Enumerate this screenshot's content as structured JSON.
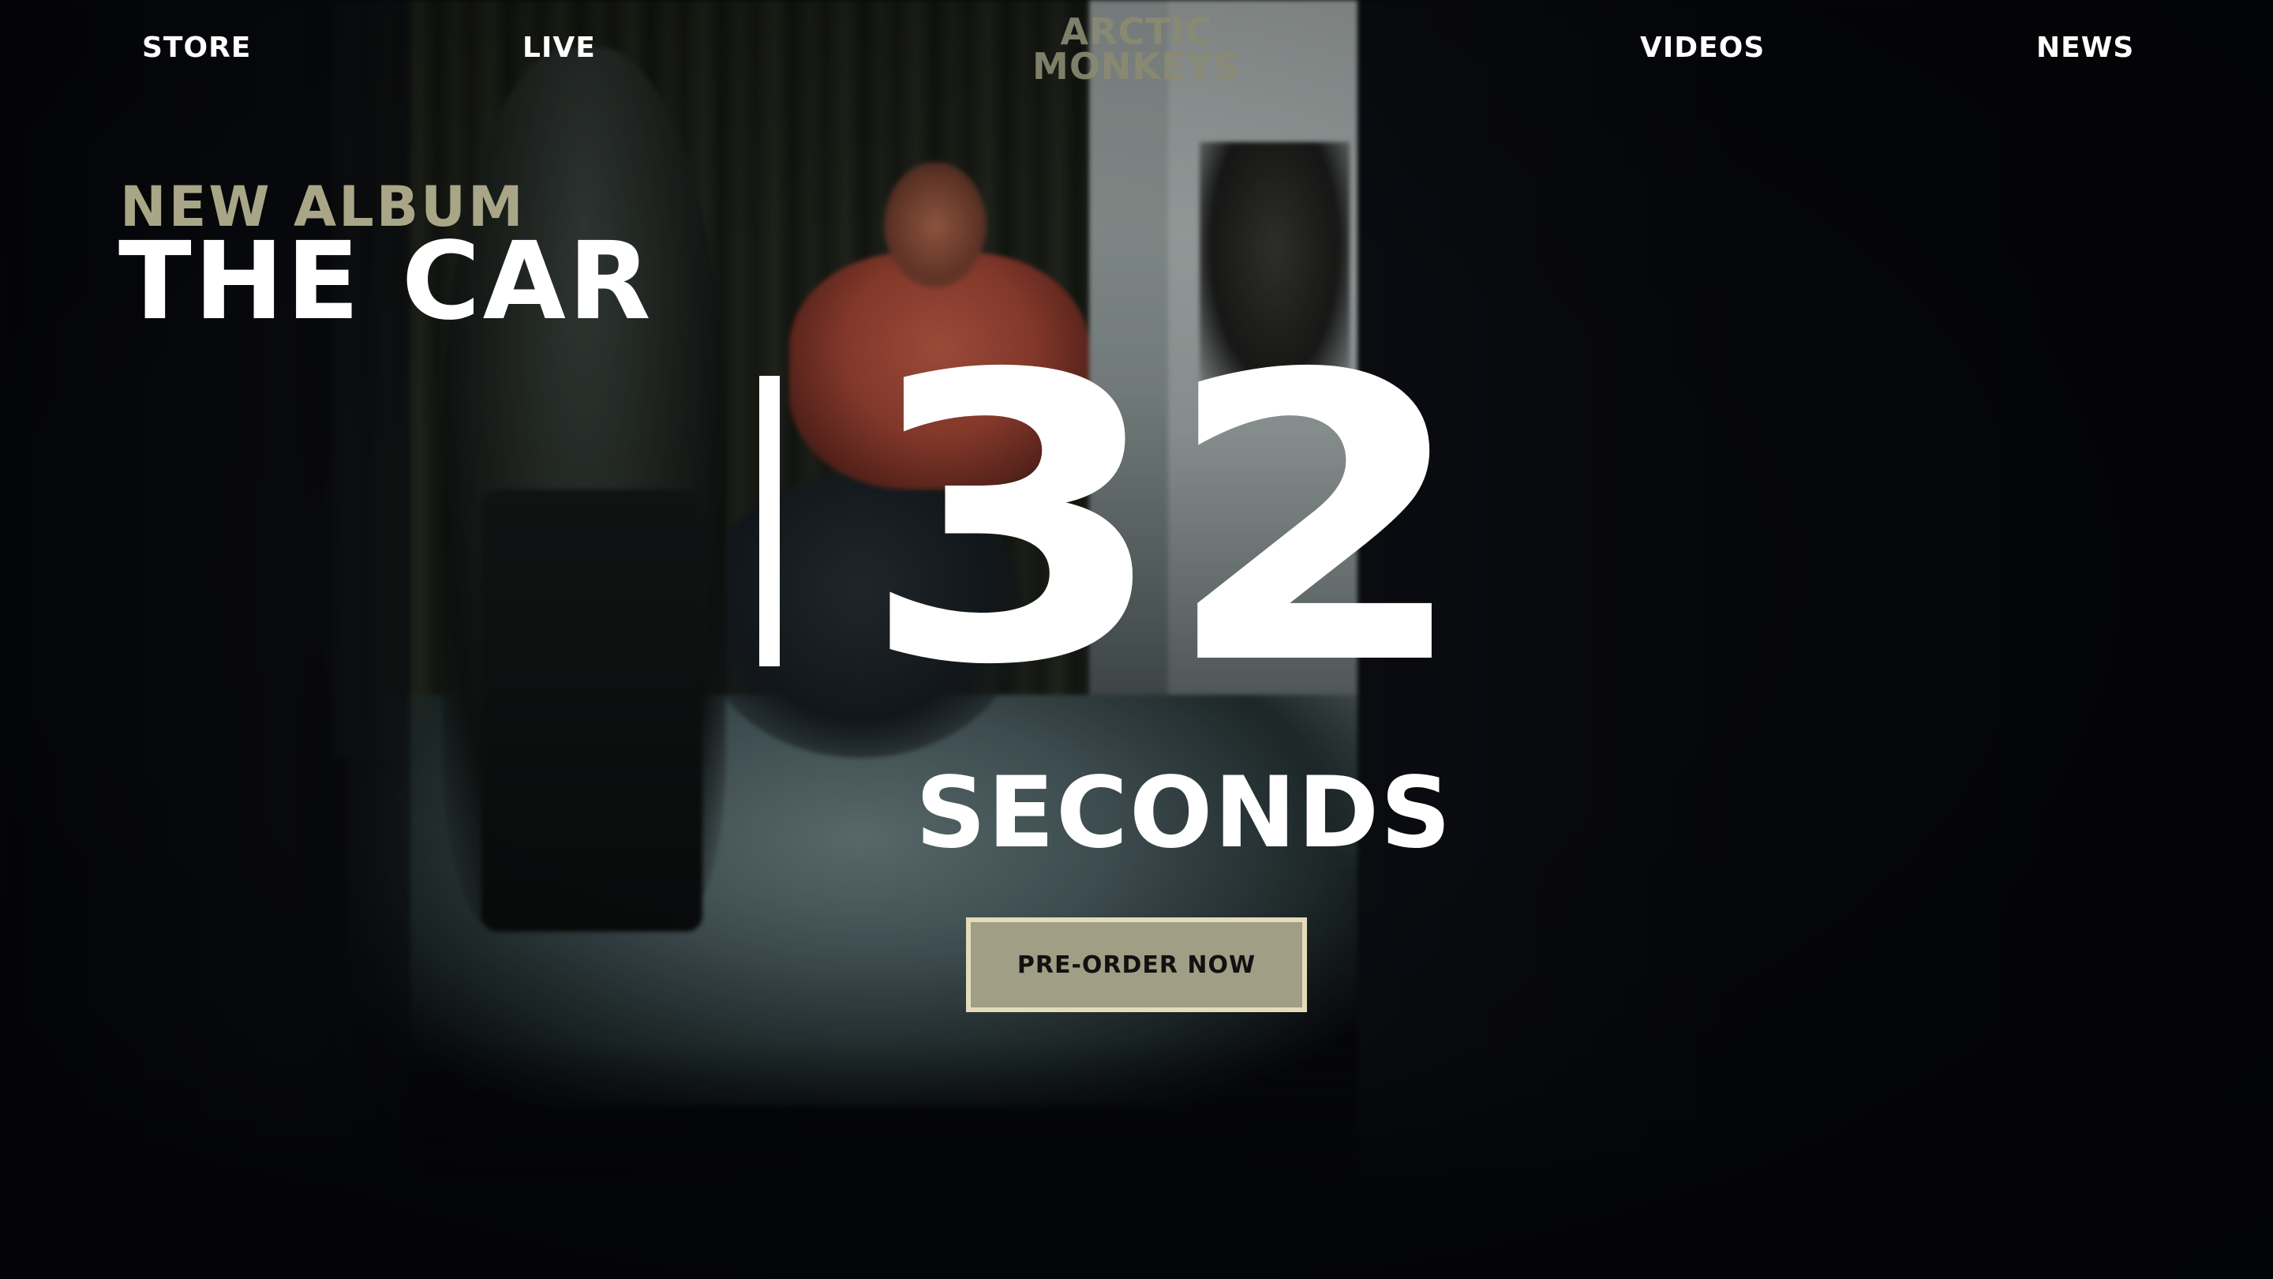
{
  "nav": {
    "store": "STORE",
    "live": "LIVE",
    "videos": "VIDEOS",
    "news": "NEWS"
  },
  "logo": {
    "line1": "ARCTIC",
    "line2": "MONKEYS"
  },
  "hero": {
    "eyebrow": "NEW ALBUM",
    "title": "THE CAR"
  },
  "countdown": {
    "value": "32",
    "unit": "SECONDS"
  },
  "cta": {
    "label": "PRE-ORDER NOW"
  },
  "colors": {
    "background": "#07080c",
    "accent_khaki": "#a9a687",
    "button_fill": "#a19e86",
    "button_border": "#e4dcb9",
    "text_primary": "#ffffff"
  }
}
